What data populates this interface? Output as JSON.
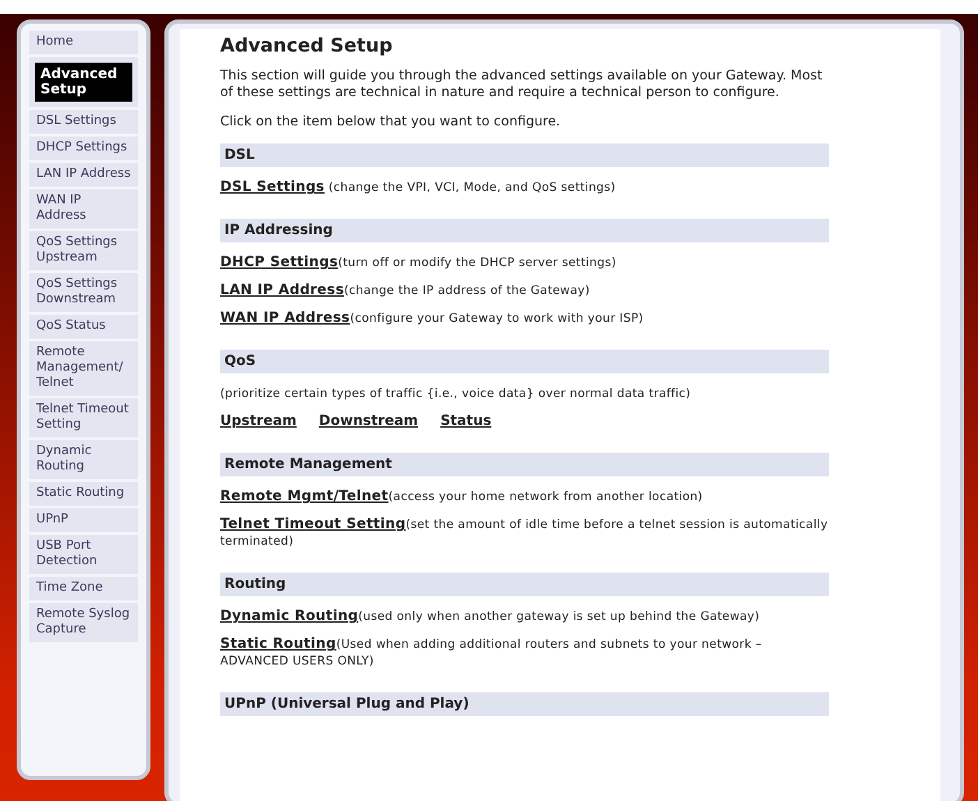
{
  "sidebar": {
    "items": [
      {
        "label": "Home",
        "selected": false
      },
      {
        "label": "Advanced Setup",
        "selected": true
      },
      {
        "label": "DSL Settings",
        "selected": false
      },
      {
        "label": "DHCP Settings",
        "selected": false
      },
      {
        "label": "LAN IP Address",
        "selected": false
      },
      {
        "label": "WAN IP Address",
        "selected": false
      },
      {
        "label": "QoS Settings Upstream",
        "selected": false
      },
      {
        "label": "QoS Settings Downstream",
        "selected": false
      },
      {
        "label": "QoS Status",
        "selected": false
      },
      {
        "label": "Remote Management/ Telnet",
        "selected": false
      },
      {
        "label": "Telnet Timeout Setting",
        "selected": false
      },
      {
        "label": "Dynamic Routing",
        "selected": false
      },
      {
        "label": "Static Routing",
        "selected": false
      },
      {
        "label": "UPnP",
        "selected": false
      },
      {
        "label": "USB Port Detection",
        "selected": false
      },
      {
        "label": "Time Zone",
        "selected": false
      },
      {
        "label": "Remote Syslog Capture",
        "selected": false
      }
    ]
  },
  "main": {
    "title": "Advanced Setup",
    "intro": [
      "This section will guide you through the advanced settings available on your Gateway. Most of these settings are technical in nature and require a technical person to configure.",
      "Click on the item below that you want to configure."
    ],
    "sections": [
      {
        "header": "DSL",
        "items": [
          {
            "kind": "link",
            "link": "DSL Settings",
            "description": " (change the VPI, VCI, Mode, and QoS settings)"
          }
        ]
      },
      {
        "header": "IP Addressing",
        "items": [
          {
            "kind": "link",
            "link": "DHCP Settings",
            "description": "(turn off or modify the DHCP server settings)"
          },
          {
            "kind": "link",
            "link": "LAN IP Address",
            "description": "(change the IP address of the Gateway)"
          },
          {
            "kind": "link",
            "link": "WAN IP Address",
            "description": "(configure your Gateway to work with your ISP)"
          }
        ]
      },
      {
        "header": "QoS",
        "items": [
          {
            "kind": "text",
            "description": "(prioritize certain types of traffic {i.e., voice data} over normal data traffic)"
          },
          {
            "kind": "links",
            "links": [
              "Upstream",
              "Downstream",
              "Status"
            ]
          }
        ]
      },
      {
        "header": "Remote Management",
        "items": [
          {
            "kind": "link",
            "link": "Remote Mgmt/Telnet",
            "description": "(access your home network from another location)"
          },
          {
            "kind": "link",
            "link": "Telnet Timeout Setting",
            "description": "(set the amount of idle time before a telnet session is automatically terminated)"
          }
        ]
      },
      {
        "header": "Routing",
        "items": [
          {
            "kind": "link",
            "link": "Dynamic Routing",
            "description": "(used only when another gateway is set up behind the Gateway)"
          },
          {
            "kind": "link",
            "link": "Static Routing",
            "description": "(Used when adding additional routers and subnets to your network – ADVANCED USERS ONLY)"
          }
        ]
      },
      {
        "header": "UPnP (Universal Plug and Play)"
      }
    ]
  }
}
